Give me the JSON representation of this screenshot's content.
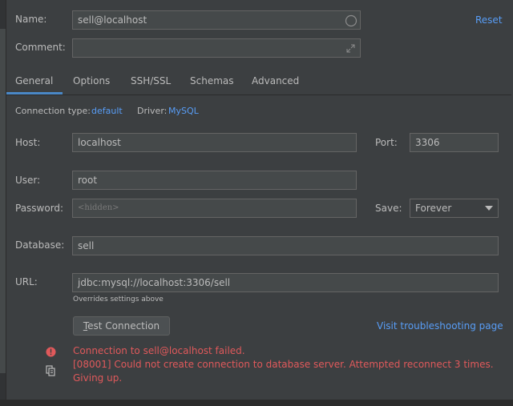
{
  "header": {
    "name_label": "Name:",
    "name_value": "sell@localhost",
    "comment_label": "Comment:",
    "comment_value": "",
    "reset_label": "Reset"
  },
  "tabs": [
    {
      "label": "General",
      "active": true
    },
    {
      "label": "Options"
    },
    {
      "label": "SSH/SSL"
    },
    {
      "label": "Schemas"
    },
    {
      "label": "Advanced"
    }
  ],
  "connection": {
    "type_label": "Connection type:",
    "type_value": "default",
    "driver_label": "Driver:",
    "driver_value": "MySQL"
  },
  "form": {
    "host_label": "Host:",
    "host_value": "localhost",
    "port_label": "Port:",
    "port_value": "3306",
    "user_label": "User:",
    "user_value": "root",
    "password_label": "Password:",
    "password_value": "<hidden>",
    "save_label": "Save:",
    "save_value": "Forever",
    "database_label": "Database:",
    "database_value": "sell",
    "url_label": "URL:",
    "url_value": "jdbc:mysql://localhost:3306/sell",
    "url_hint": "Overrides settings above"
  },
  "actions": {
    "test_connection_mnemonic": "T",
    "test_connection_rest": "est Connection",
    "troubleshoot_label": "Visit troubleshooting page"
  },
  "error": {
    "line1": "Connection to sell@localhost failed.",
    "line2": "[08001] Could not create connection to database server. Attempted reconnect 3 times.",
    "line3": "Giving up."
  },
  "colors": {
    "background": "#3c3f41",
    "field_background": "#45494a",
    "link": "#589df6",
    "error": "#e0595b",
    "tab_underline": "#4a88c7"
  }
}
